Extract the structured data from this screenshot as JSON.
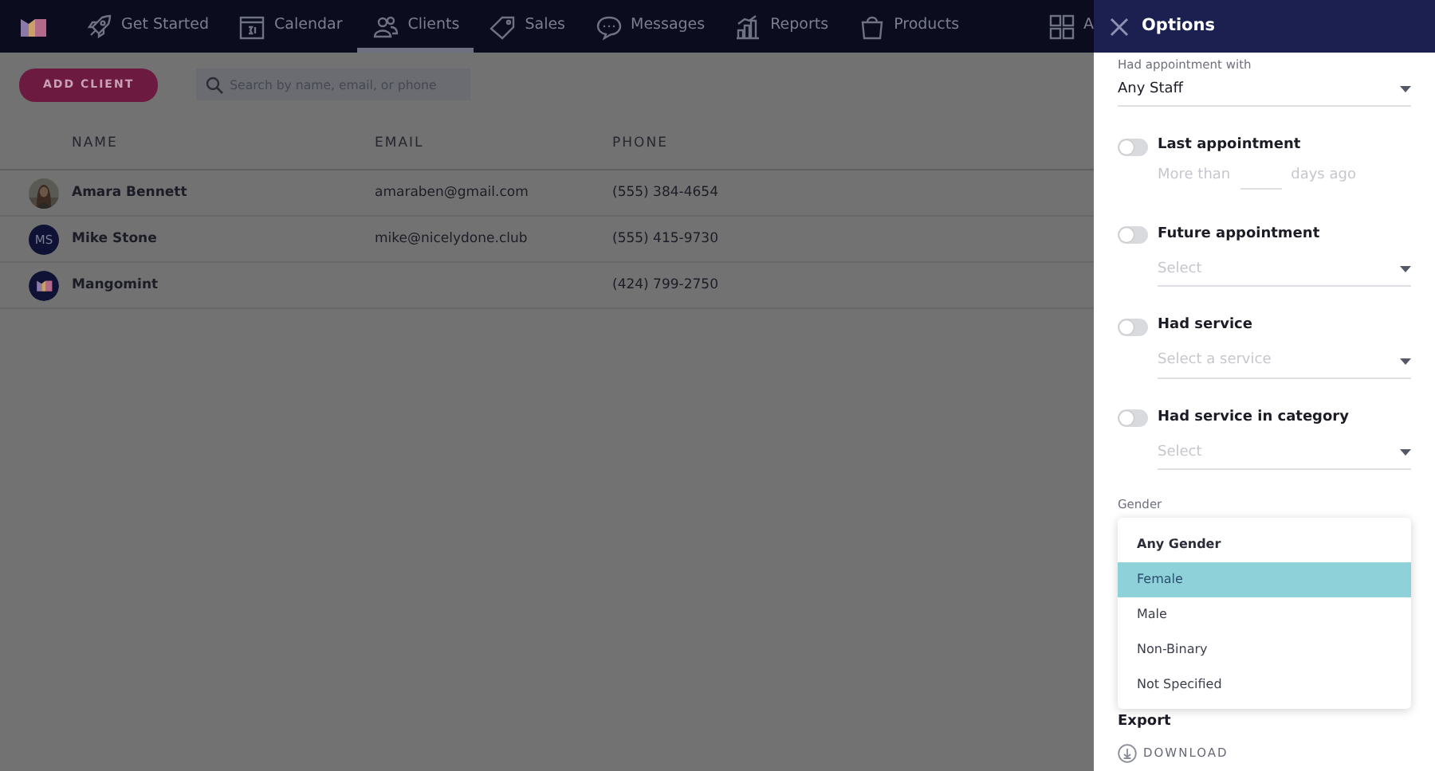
{
  "nav": {
    "items": [
      {
        "label": "Get Started",
        "selected": false
      },
      {
        "label": "Calendar",
        "selected": false
      },
      {
        "label": "Clients",
        "selected": true
      },
      {
        "label": "Sales",
        "selected": false
      },
      {
        "label": "Messages",
        "selected": false
      },
      {
        "label": "Reports",
        "selected": false
      },
      {
        "label": "Products",
        "selected": false
      },
      {
        "label": "A",
        "selected": false
      }
    ]
  },
  "toolbar": {
    "add_button": "ADD CLIENT",
    "search": {
      "placeholder": "Search by name, email, or phone"
    }
  },
  "table": {
    "columns": [
      "NAME",
      "EMAIL",
      "PHONE"
    ],
    "rows": [
      {
        "name": "Amara Bennett",
        "email": "amaraben@gmail.com",
        "phone": "(555) 384-4654"
      },
      {
        "avatar": {
          "kind": "initials",
          "text": "MS"
        },
        "name": "Mike Stone",
        "email": "mike@nicelydone.club",
        "phone": "(555) 415-9730"
      },
      {
        "avatar": {
          "kind": "logo"
        },
        "name": "Mangomint",
        "phone": "(424) 799-2750"
      }
    ]
  },
  "panel": {
    "title": "Options",
    "filters": [
      {
        "kind": "select",
        "label": "Had appointment with",
        "value": "Any Staff"
      },
      {
        "kind": "days",
        "label": "Last appointment",
        "on": false,
        "before": "More than",
        "after": "days ago"
      },
      {
        "kind": "toggle-select",
        "label": "Future appointment",
        "on": false,
        "placeholder": "Select"
      },
      {
        "kind": "toggle-select",
        "label": "Had service",
        "on": false,
        "placeholder": "Select a service"
      },
      {
        "kind": "toggle-select",
        "label": "Had service in category",
        "on": false,
        "placeholder": "Select"
      }
    ],
    "gender": {
      "label": "Gender",
      "options": [
        {
          "label": "Any Gender",
          "current": true,
          "selected": false
        },
        {
          "label": "Female",
          "current": false,
          "selected": true
        },
        {
          "label": "Male",
          "current": false,
          "selected": false
        },
        {
          "label": "Non-Binary",
          "current": false,
          "selected": false
        },
        {
          "label": "Not Specified",
          "current": false,
          "selected": false
        }
      ]
    },
    "export": {
      "title": "Export",
      "action": "DOWNLOAD"
    }
  }
}
